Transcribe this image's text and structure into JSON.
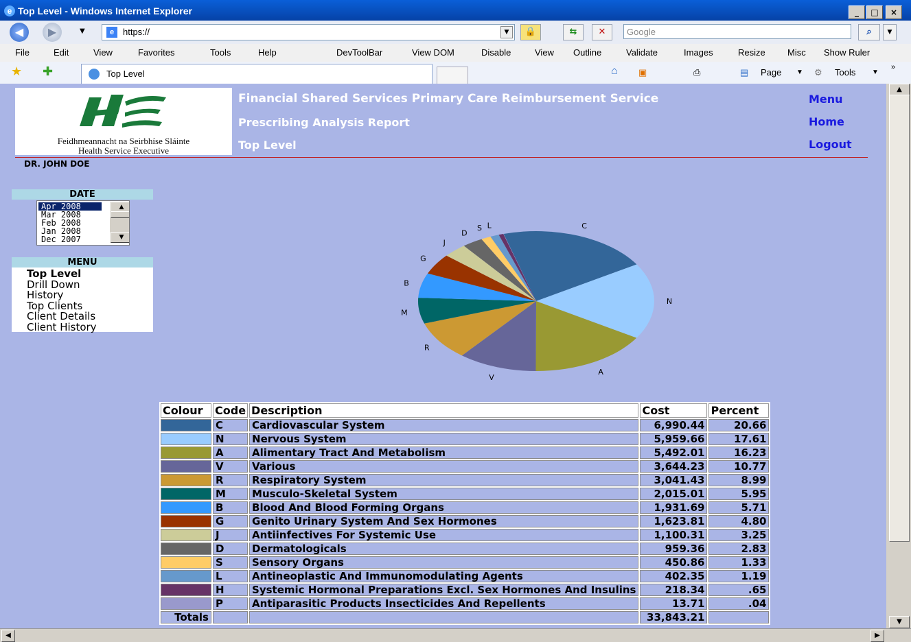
{
  "window": {
    "title": "Top Level - Windows Internet Explorer",
    "minimize": "_",
    "maximize": "□",
    "close": "×"
  },
  "address": {
    "url": "https://",
    "search_placeholder": "Google"
  },
  "menus": [
    "File",
    "Edit",
    "View",
    "Favorites",
    "Tools",
    "Help",
    "DevToolBar",
    "View DOM",
    "Disable",
    "View",
    "Outline",
    "Validate",
    "Images",
    "Resize",
    "Misc",
    "Show Ruler"
  ],
  "tab": {
    "label": "Top Level"
  },
  "toolbar_right": {
    "page": "Page",
    "tools": "Tools"
  },
  "logo": {
    "line1": "Feidhmeannacht na Seirbhíse Sláinte",
    "line2": "Health Service Executive"
  },
  "header": {
    "title": "Financial Shared Services Primary Care Reimbursement Service",
    "subtitle": "Prescribing Analysis Report",
    "page": "Top Level"
  },
  "links": {
    "menu": "Menu",
    "home": "Home",
    "logout": "Logout"
  },
  "doctor": "DR. JOHN DOE",
  "date": {
    "heading": "DATE",
    "options": [
      "Apr 2008",
      "Mar 2008",
      "Feb 2008",
      "Jan 2008",
      "Dec 2007"
    ],
    "selected": "Apr 2008"
  },
  "sidemenu": {
    "heading": "MENU",
    "items": [
      "Top Level",
      "Drill Down",
      "History",
      "Top Clients",
      "Client Details",
      "Client History"
    ],
    "current": "Top Level"
  },
  "table": {
    "headers": [
      "Colour",
      "Code",
      "Description",
      "Cost",
      "Percent"
    ],
    "rows": [
      {
        "code": "C",
        "description": "Cardiovascular System",
        "cost": "6,990.44",
        "percent": "20.66",
        "color": "#336699"
      },
      {
        "code": "N",
        "description": "Nervous System",
        "cost": "5,959.66",
        "percent": "17.61",
        "color": "#99ccff"
      },
      {
        "code": "A",
        "description": "Alimentary Tract And Metabolism",
        "cost": "5,492.01",
        "percent": "16.23",
        "color": "#999933"
      },
      {
        "code": "V",
        "description": "Various",
        "cost": "3,644.23",
        "percent": "10.77",
        "color": "#666699"
      },
      {
        "code": "R",
        "description": "Respiratory System",
        "cost": "3,041.43",
        "percent": "8.99",
        "color": "#cc9933"
      },
      {
        "code": "M",
        "description": "Musculo-Skeletal System",
        "cost": "2,015.01",
        "percent": "5.95",
        "color": "#006666"
      },
      {
        "code": "B",
        "description": "Blood And Blood Forming Organs",
        "cost": "1,931.69",
        "percent": "5.71",
        "color": "#3399ff"
      },
      {
        "code": "G",
        "description": "Genito Urinary System And Sex Hormones",
        "cost": "1,623.81",
        "percent": "4.80",
        "color": "#993300"
      },
      {
        "code": "J",
        "description": "Antiinfectives For Systemic Use",
        "cost": "1,100.31",
        "percent": "3.25",
        "color": "#cccc99"
      },
      {
        "code": "D",
        "description": "Dermatologicals",
        "cost": "959.36",
        "percent": "2.83",
        "color": "#666666"
      },
      {
        "code": "S",
        "description": "Sensory Organs",
        "cost": "450.86",
        "percent": "1.33",
        "color": "#ffcc66"
      },
      {
        "code": "L",
        "description": "Antineoplastic And Immunomodulating Agents",
        "cost": "402.35",
        "percent": "1.19",
        "color": "#6699cc"
      },
      {
        "code": "H",
        "description": "Systemic Hormonal Preparations Excl. Sex Hormones And Insulins",
        "cost": "218.34",
        "percent": ".65",
        "color": "#663366"
      },
      {
        "code": "P",
        "description": "Antiparasitic Products Insecticides And Repellents",
        "cost": "13.71",
        "percent": ".04",
        "color": "#9999cc"
      }
    ],
    "totals_label": "Totals",
    "totals_cost": "33,843.21"
  },
  "chart_data": {
    "type": "pie",
    "categories": [
      "C",
      "N",
      "A",
      "V",
      "R",
      "M",
      "B",
      "G",
      "J",
      "D",
      "S",
      "L",
      "H",
      "P"
    ],
    "values": [
      20.66,
      17.61,
      16.23,
      10.77,
      8.99,
      5.95,
      5.71,
      4.8,
      3.25,
      2.83,
      1.33,
      1.19,
      0.65,
      0.04
    ],
    "colors": [
      "#336699",
      "#99ccff",
      "#999933",
      "#666699",
      "#cc9933",
      "#006666",
      "#3399ff",
      "#993300",
      "#cccc99",
      "#666666",
      "#ffcc66",
      "#6699cc",
      "#663366",
      "#9999cc"
    ],
    "labels": [
      "C",
      "N",
      "A",
      "V",
      "R",
      "M",
      "B",
      "G",
      "J",
      "D",
      "S",
      "L",
      "",
      ""
    ]
  }
}
